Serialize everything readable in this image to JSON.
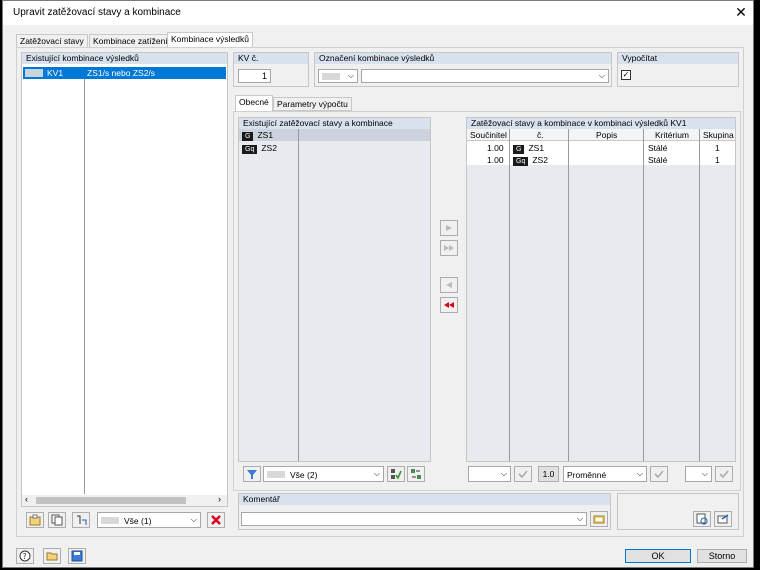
{
  "window": {
    "title": "Upravit zatěžovací stavy a kombinace",
    "close": "✕"
  },
  "tabs": [
    "Zatěžovací stavy",
    "Kombinace zatížení",
    "Kombinace výsledků"
  ],
  "left_panel": {
    "header": "Existující kombinace výsledků",
    "row": {
      "id": "KV1",
      "description": "ZS1/s nebo ZS2/s"
    },
    "filter_value": "Vše (1)"
  },
  "kv_no": {
    "label": "KV č.",
    "value": "1"
  },
  "designation": {
    "label": "Označení kombinace výsledků",
    "value": ""
  },
  "compute": {
    "label": "Vypočítat",
    "checked": true
  },
  "subtabs": [
    "Obecné",
    "Parametry výpočtu"
  ],
  "existing_lc": {
    "header": "Existující zatěžovací stavy a kombinace",
    "rows": [
      {
        "tag": "G",
        "name": "ZS1"
      },
      {
        "tag": "Gq",
        "name": "ZS2"
      }
    ],
    "filter_value": "Vše (2)"
  },
  "combo_table": {
    "header": "Zatěžovací stavy a kombinace v kombinaci výsledků KV1",
    "columns": [
      "Součinitel",
      "č.",
      "Popis",
      "Kritérium",
      "Skupina"
    ],
    "rows": [
      {
        "factor": "1.00",
        "tag": "G",
        "no": "ZS1",
        "desc": "",
        "criterion": "Stálé",
        "group": "1"
      },
      {
        "factor": "1.00",
        "tag": "Gq",
        "no": "ZS2",
        "desc": "",
        "criterion": "Stálé",
        "group": "1"
      }
    ],
    "factor_value": "1.0",
    "criterion_value": "Proměnné"
  },
  "comment": {
    "label": "Komentář",
    "value": ""
  },
  "footer": {
    "ok": "OK",
    "cancel": "Storno"
  }
}
